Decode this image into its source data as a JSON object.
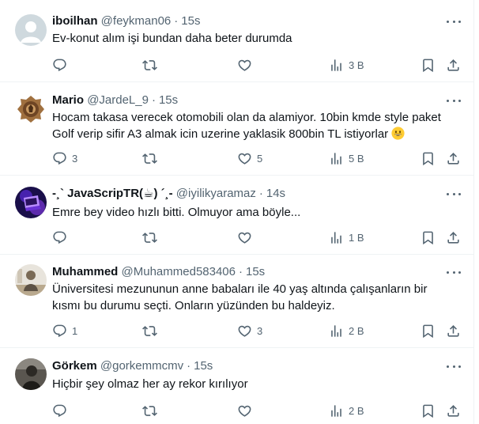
{
  "tweets": [
    {
      "name": "iboilhan",
      "handle": "@feykman06",
      "time": "15s",
      "text": "Ev-konut alım işi bundan daha beter durumda",
      "text2": "",
      "avatar": "default-avatar",
      "replies": "",
      "retweets": "",
      "likes": "",
      "views": "3 B"
    },
    {
      "name": "Mario",
      "handle": "@JardeL_9",
      "time": "15s",
      "text": "Hocam takasa verecek otomobili olan da alamiyor. 10bin kmde style paket",
      "text2": "Golf verip sifir A3 almak icin uzerine yaklasik 800bin TL istiyorlar",
      "emoji": "grinning-face-emoji",
      "avatar": "crest-avatar",
      "replies": "3",
      "retweets": "",
      "likes": "5",
      "views": "5 B"
    },
    {
      "name": "-¸` JavaScripTR(☕) ´¸-",
      "handle": "@iyilikyaramaz",
      "time": "14s",
      "text": "Emre bey video hızlı bitti. Olmuyor ama böyle...",
      "text2": "",
      "avatar": "purple-laptop-avatar",
      "replies": "",
      "retweets": "",
      "likes": "",
      "views": "1 B"
    },
    {
      "name": "Muhammed",
      "handle": "@Muhammed583406",
      "time": "15s",
      "text": "Üniversitesi mezununun anne babaları ile 40 yaş altında çalışanların bir",
      "text2": "kısmı bu durumu seçti. Onların yüzünden bu haldeyiz.",
      "avatar": "photo-avatar",
      "replies": "1",
      "retweets": "",
      "likes": "3",
      "views": "2 B"
    },
    {
      "name": "Görkem",
      "handle": "@gorkemmcmv",
      "time": "15s",
      "text": "Hiçbir şey olmaz her ay rekor kırılıyor",
      "text2": "",
      "avatar": "dark-photo-avatar",
      "replies": "",
      "retweets": "",
      "likes": "",
      "views": "2 B"
    }
  ],
  "dot": "·",
  "colors": {
    "text": "#0f1419",
    "secondary": "#536471",
    "border": "#eff3f4"
  }
}
